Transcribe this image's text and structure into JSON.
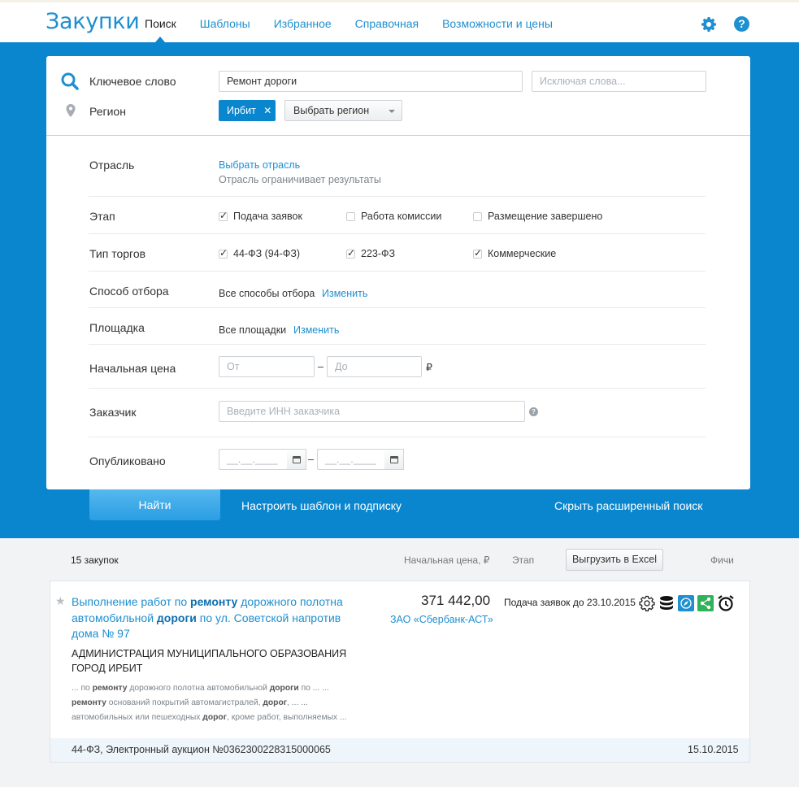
{
  "header": {
    "logo": "Закупки",
    "nav": [
      "Поиск",
      "Шаблоны",
      "Избранное",
      "Справочная",
      "Возможности и цены"
    ],
    "active_nav": 0
  },
  "search": {
    "keyword_label": "Ключевое слово",
    "keyword_value": "Ремонт дороги",
    "exclude_placeholder": "Исключая слова...",
    "region_label": "Регион",
    "region_chip": "Ирбит",
    "region_select": "Выбрать регион"
  },
  "filters": {
    "industry_label": "Отрасль",
    "industry_link": "Выбрать отрасль",
    "industry_note": "Отрасль ограничивает результаты",
    "stage_label": "Этап",
    "stage_options": [
      {
        "label": "Подача заявок",
        "checked": true
      },
      {
        "label": "Работа комиссии",
        "checked": false
      },
      {
        "label": "Размещение завершено",
        "checked": false
      }
    ],
    "trade_label": "Тип торгов",
    "trade_options": [
      {
        "label": "44-ФЗ (94-ФЗ)",
        "checked": true
      },
      {
        "label": "223-ФЗ",
        "checked": true
      },
      {
        "label": "Коммерческие",
        "checked": true
      }
    ],
    "method_label": "Способ отбора",
    "method_value": "Все способы отбора",
    "method_link": "Изменить",
    "platform_label": "Площадка",
    "platform_value": "Все площадки",
    "platform_link": "Изменить",
    "price_label": "Начальная цена",
    "price_from_placeholder": "От",
    "price_dash": "–",
    "price_to_placeholder": "До",
    "price_currency": "₽",
    "customer_label": "Заказчик",
    "customer_placeholder": "Введите ИНН заказчика",
    "published_label": "Опубликовано",
    "date_placeholder": "__.__.____",
    "date_dash": "–"
  },
  "actions": {
    "find": "Найти",
    "template": "Настроить шаблон и подписку",
    "hide": "Скрыть расширенный поиск"
  },
  "results": {
    "count": "15 закупок",
    "col_price": "Начальная цена, ₽",
    "col_stage": "Этап",
    "excel": "Выгрузить в Excel",
    "col_features": "Фичи",
    "items": [
      {
        "title_parts": [
          "Выполнение работ по ",
          "ремонту",
          " дорожного полотна автомобильной ",
          "дороги",
          " по ул. Советской напротив дома № 97"
        ],
        "customer": "АДМИНИСТРАЦИЯ МУНИЦИПАЛЬНОГО ОБРАЗОВАНИЯ ГОРОД ИРБИТ",
        "snippet_lines": [
          [
            "... по ",
            "ремонту",
            " дорожного полотна автомобильной ",
            "дороги",
            " по ... ..."
          ],
          [
            "ремонту",
            " оснований покрытий автомагистралей, ",
            "дорог",
            ", ... ..."
          ],
          [
            "автомобильных или пешеходных ",
            "дорог",
            ", кроме работ, выполняемых ..."
          ]
        ],
        "price": "371 442,00",
        "platform": "ЗАО «Сбербанк-АСТ»",
        "stage": "Подача заявок до 23.10.2015",
        "features": [
          "gear-icon",
          "coins-icon",
          "compass-icon",
          "share-icon",
          "alarm-icon"
        ],
        "footer_left": "44-ФЗ, Электронный аукцион №0362300228315000065",
        "footer_date": "15.10.2015"
      }
    ]
  },
  "colors": {
    "brand": "#0a86cf",
    "link": "#1e8fd0",
    "green": "#2fb25a"
  }
}
